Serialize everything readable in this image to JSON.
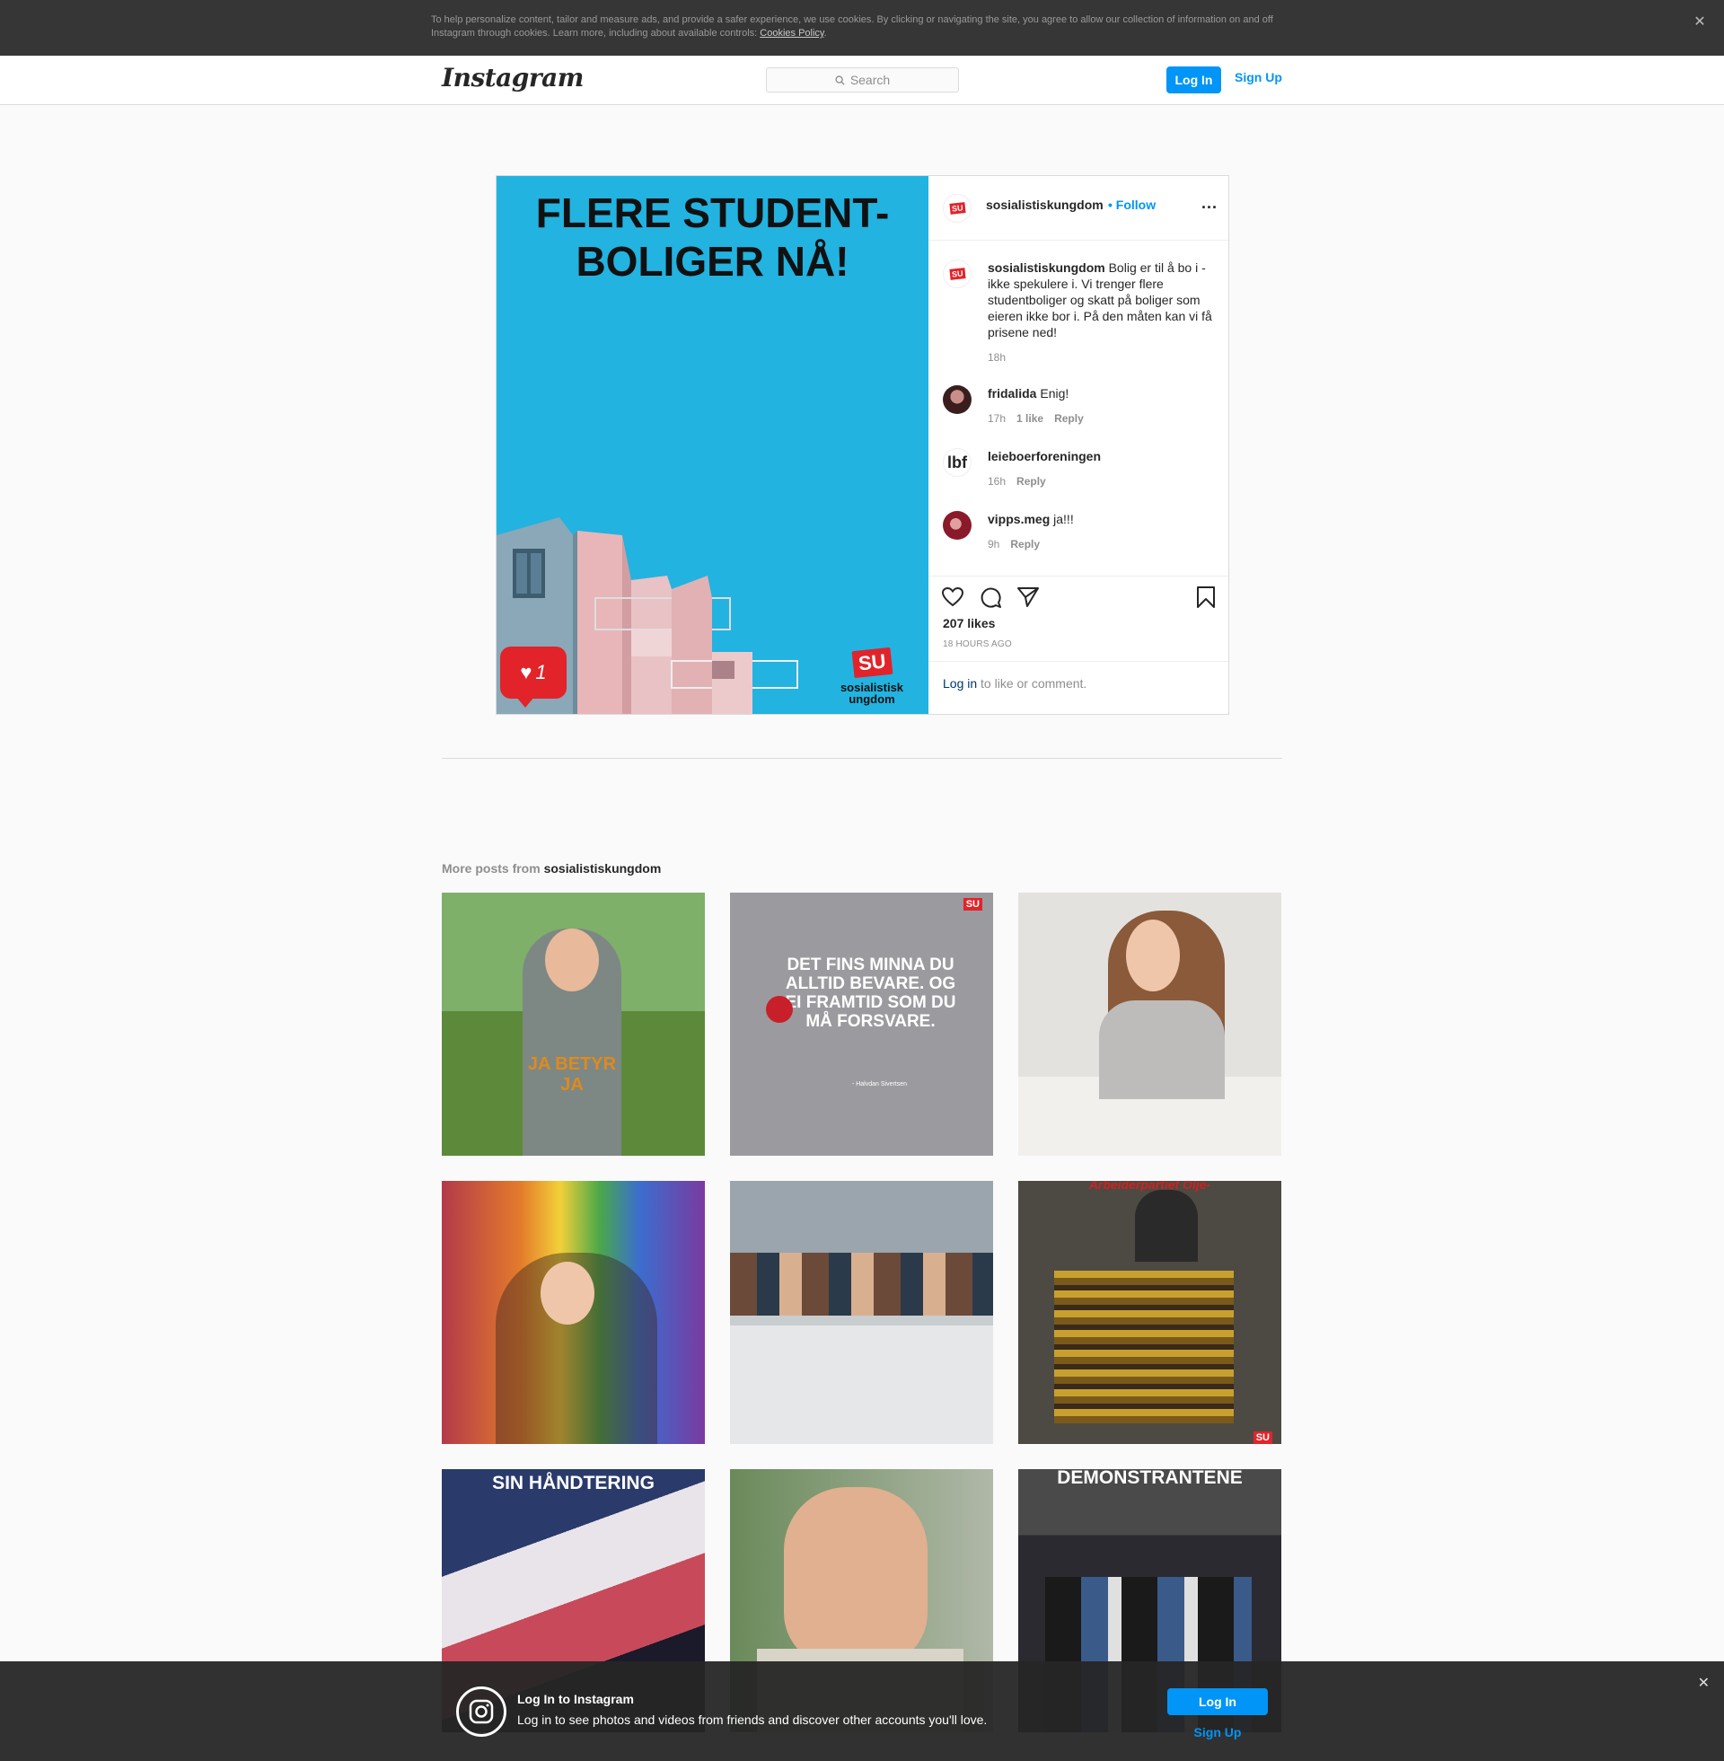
{
  "cookie": {
    "text": "To help personalize content, tailor and measure ads, and provide a safer experience, we use cookies. By clicking or navigating the site, you agree to allow our collection of information on and off Instagram through cookies. Learn more, including about available controls: ",
    "link": "Cookies Policy",
    "tail": ".",
    "close": "✕"
  },
  "nav": {
    "logo": "Instagram",
    "search_placeholder": "Search",
    "login": "Log In",
    "signup": "Sign Up"
  },
  "post": {
    "headline_line1": "FLERE STUDENT-",
    "headline_line2": "BOLIGER NÅ!",
    "logo_badge": "SU",
    "logo_word1": "sosialistisk",
    "logo_word2": "ungdom",
    "like_notification_count": "1",
    "username": "sosialistiskungdom",
    "follow": "• Follow",
    "more": "...",
    "caption": {
      "user": "sosialistiskungdom",
      "text": " Bolig er til å bo i - ikke spekulere i. Vi trenger flere studentboliger og skatt på boliger som eieren ikke bor i. På den måten kan vi få prisene ned!",
      "time": "18h"
    },
    "comments": [
      {
        "user": "fridalida",
        "text": " Enig!",
        "time": "17h",
        "likes": "1 like",
        "reply": "Reply"
      },
      {
        "user": "leieboerforeningen",
        "text": " ",
        "time": "16h",
        "likes": "",
        "reply": "Reply",
        "avatar_text": "lbf"
      },
      {
        "user": "vipps.meg",
        "text": " ja!!! ",
        "time": "9h",
        "likes": "",
        "reply": "Reply"
      }
    ],
    "likes": "207 likes",
    "time_ago": "18 HOURS AGO",
    "login_link": "Log in",
    "login_tail": " to like or comment."
  },
  "more_posts": {
    "prefix": "More posts from ",
    "user": "sosialistiskungdom",
    "tiles": [
      {
        "caption": "JA BETYR JA",
        "color": "#5d8a3a"
      },
      {
        "caption": "DET FINS MINNA DU ALLTID BEVARE. OG EI FRAMTID SOM DU MÅ FORSVARE.",
        "subcaption": "- Halvdan Sivertsen",
        "color": "#9b9b9f"
      },
      {
        "caption": "",
        "color": "#d9d6d2"
      },
      {
        "caption": "",
        "color": "#b33a4a"
      },
      {
        "caption": "",
        "color": "#8fa0ad"
      },
      {
        "caption": "Arbeiderpartiet Olje-",
        "color": "#4d4a43"
      },
      {
        "caption": "SIN HÅNDTERING",
        "color": "#6b7a9a"
      },
      {
        "caption": "",
        "color": "#8a9a7a"
      },
      {
        "caption": "DEMONSTRANTENE",
        "color": "#3d3d3d"
      }
    ]
  },
  "banner": {
    "title": "Log In to Instagram",
    "subtitle": "Log in to see photos and videos from friends and discover other accounts you'll love.",
    "login": "Log In",
    "signup": "Sign Up",
    "close": "✕"
  }
}
